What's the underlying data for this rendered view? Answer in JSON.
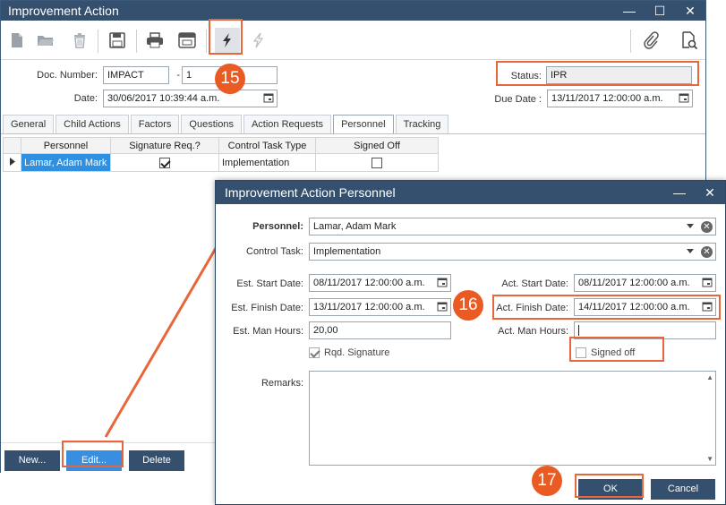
{
  "main": {
    "title": "Improvement Action",
    "controls": {
      "minimize": "—",
      "maximize": "☐",
      "close": "✕"
    },
    "form": {
      "doc_number_label": "Doc. Number:",
      "doc_number_value": "IMPACT",
      "doc_dash": "-",
      "doc_revision": "1",
      "date_label": "Date:",
      "date_value": "30/06/2017 10:39:44 a.m.",
      "status_label": "Status:",
      "status_value": "IPR",
      "due_date_label": "Due Date :",
      "due_date_value": "13/11/2017 12:00:00 a.m."
    },
    "tabs": [
      "General",
      "Child Actions",
      "Factors",
      "Questions",
      "Action Requests",
      "Personnel",
      "Tracking"
    ],
    "active_tab": "Personnel",
    "grid": {
      "columns": [
        "Personnel",
        "Signature Req.?",
        "Control Task Type",
        "Signed Off"
      ],
      "rows": [
        {
          "personnel": "Lamar, Adam Mark",
          "signature_req": true,
          "control_task_type": "Implementation",
          "signed_off": false
        }
      ]
    },
    "buttons": {
      "new": "New...",
      "edit": "Edit...",
      "delete": "Delete"
    }
  },
  "dialog": {
    "title": "Improvement Action Personnel",
    "controls": {
      "minimize": "—",
      "close": "✕"
    },
    "personnel_label": "Personnel:",
    "personnel_value": "Lamar, Adam Mark",
    "control_task_label": "Control Task:",
    "control_task_value": "Implementation",
    "est_start_label": "Est. Start Date:",
    "est_start_value": "08/11/2017 12:00:00 a.m.",
    "est_finish_label": "Est. Finish Date:",
    "est_finish_value": "13/11/2017 12:00:00 a.m.",
    "est_hours_label": "Est. Man Hours:",
    "est_hours_value": "20,00",
    "act_start_label": "Act. Start Date:",
    "act_start_value": "08/11/2017 12:00:00 a.m.",
    "act_finish_label": "Act. Finish Date:",
    "act_finish_value": "14/11/2017 12:00:00 a.m.",
    "act_hours_label": "Act. Man Hours:",
    "act_hours_value": "",
    "rqd_signature_label": "Rqd. Signature",
    "rqd_signature_checked": true,
    "signed_off_label": "Signed off",
    "signed_off_checked": false,
    "remarks_label": "Remarks:",
    "ok_label": "OK",
    "cancel_label": "Cancel"
  },
  "annotations": {
    "step_15": "15",
    "step_16": "16",
    "step_17": "17"
  },
  "colors": {
    "titlebar": "#34506e",
    "accent_orange": "#ea5b24",
    "selection": "#2f8fe0"
  }
}
